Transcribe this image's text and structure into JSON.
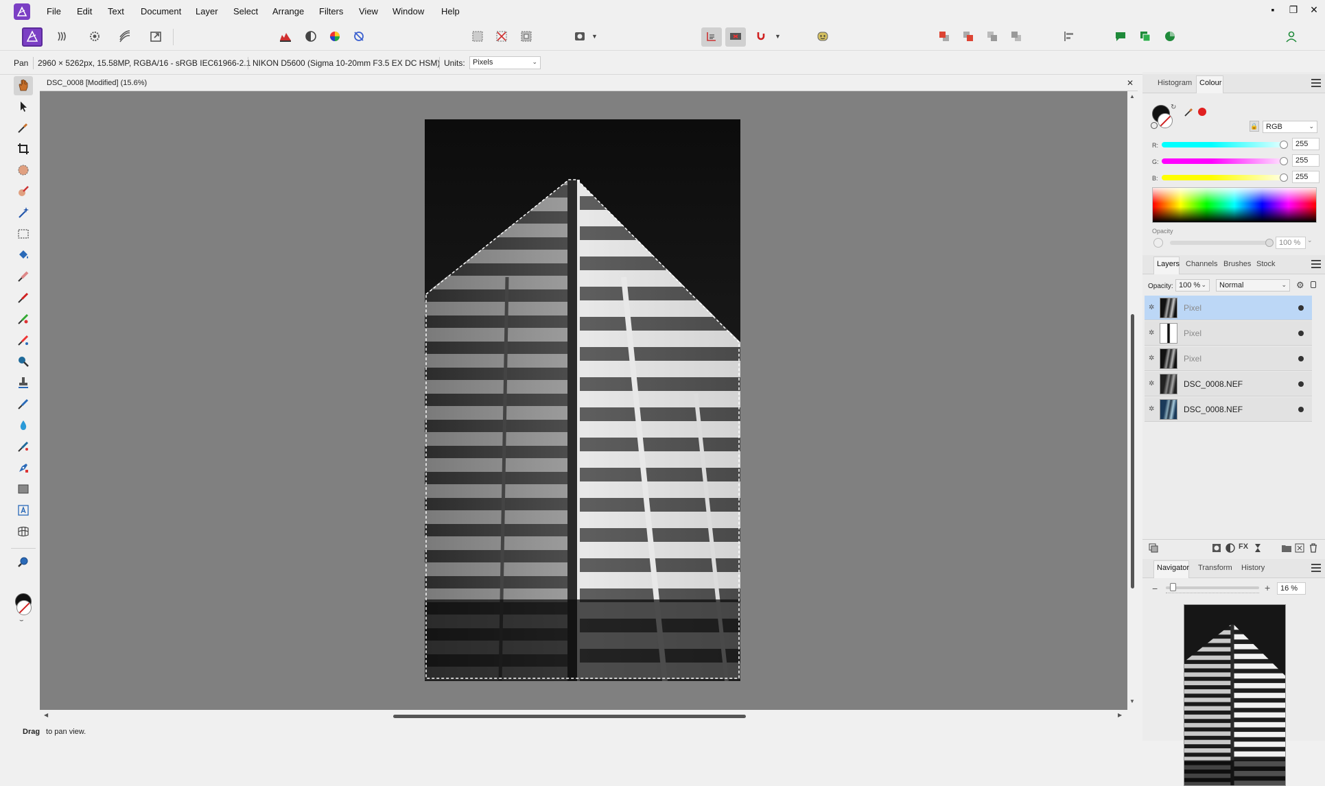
{
  "menu": {
    "items": [
      "File",
      "Edit",
      "Text",
      "Document",
      "Layer",
      "Select",
      "Arrange",
      "Filters",
      "View",
      "Window",
      "Help"
    ],
    "window_controls": {
      "minimize": "▪",
      "restore": "❐",
      "close": "✕"
    }
  },
  "context": {
    "tool_name": "Pan",
    "image_info": "2960 × 5262px, 15.58MP, RGBA/16 - sRGB IEC61966-2.1",
    "camera": "NIKON D5600 (Sigma 10-20mm F3.5 EX DC HSM)",
    "units_label": "Units:",
    "units_value": "Pixels"
  },
  "document": {
    "tab_title": "DSC_0008 [Modified] (15.6%)",
    "close_glyph": "✕"
  },
  "status": {
    "bold": "Drag",
    "rest": " to pan view."
  },
  "colour_panel": {
    "tabs": [
      "Histogram",
      "Colour"
    ],
    "active_tab": "Colour",
    "model": "RGB",
    "r_label": "R:",
    "r_value": "255",
    "g_label": "G:",
    "g_value": "255",
    "b_label": "B:",
    "b_value": "255",
    "opacity_label": "Opacity",
    "opacity_value": "100 %"
  },
  "layers_panel": {
    "tabs": [
      "Layers",
      "Channels",
      "Brushes",
      "Stock"
    ],
    "active_tab": "Layers",
    "opacity_label": "Opacity:",
    "opacity_value": "100 %",
    "blend_mode": "Normal",
    "layers": [
      {
        "name": "Pixel",
        "selected": true,
        "dim": true
      },
      {
        "name": "Pixel",
        "selected": false,
        "dim": true
      },
      {
        "name": "Pixel",
        "selected": false,
        "dim": true
      },
      {
        "name": "DSC_0008.NEF",
        "selected": false,
        "dim": false
      },
      {
        "name": "DSC_0008.NEF",
        "selected": false,
        "dim": false
      }
    ]
  },
  "navigator_panel": {
    "tabs": [
      "Navigator",
      "Transform",
      "History"
    ],
    "active_tab": "Navigator",
    "zoom_value": "16 %",
    "zoom_fraction": 0.05
  },
  "colors": {
    "accent_purple": "#7b3fc4",
    "selection_blue": "#bcd7f6",
    "canvas_gray": "#808080",
    "primary_colour": "#111111",
    "red_swatch": "#e02020"
  }
}
